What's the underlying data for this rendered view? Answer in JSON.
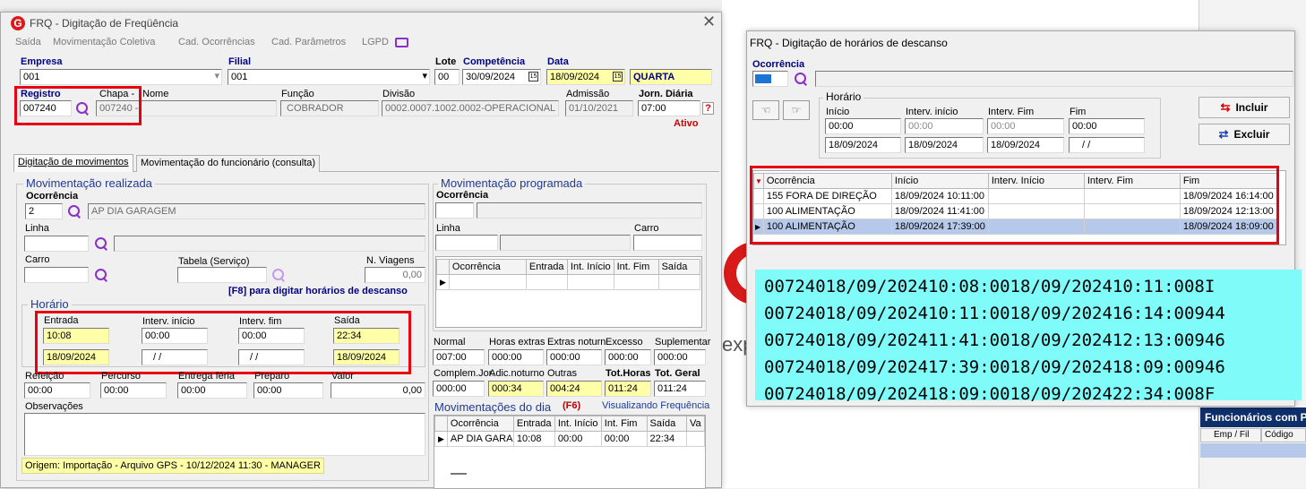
{
  "win1": {
    "title": "FRQ - Digitação de Freqüência",
    "menu": [
      "Saída",
      "Movimentação Coletiva",
      "Cad. Ocorrências",
      "Cad. Parâmetros",
      "LGPD"
    ],
    "empresa_label": "Empresa",
    "empresa_value": "001",
    "filial_label": "Filial",
    "filial_value": "001",
    "lote_label": "Lote",
    "lote_value": "00",
    "competencia_label": "Competência",
    "competencia_value": "30/09/2024",
    "data_label": "Data",
    "data_value": "18/09/2024",
    "dia_semana": "QUARTA",
    "registro_label": "Registro",
    "registro_value": "007240",
    "chapa_label": "Chapa -",
    "chapa_value": "007240 - ",
    "nome_label": "Nome",
    "funcao_label": "Função",
    "funcao_value": "COBRADOR",
    "divisao_label": "Divisão",
    "divisao_value": "0002.0007.1002.0002-OPERACIONAL",
    "admissao_label": "Admissão",
    "admissao_value": "01/10/2021",
    "jorn_label": "Jorn. Diária",
    "jorn_value": "07:00",
    "status": "Ativo",
    "tabs": [
      "Digitação de movimentos",
      "Movimentação do funcionário (consulta)"
    ],
    "mov_real": {
      "title": "Movimentação realizada",
      "ocorrencia_label": "Ocorrência",
      "ocorrencia_code": "2",
      "ocorrencia_desc": "AP DIA GARAGEM",
      "linha_label": "Linha",
      "carro_label": "Carro",
      "tabela_label": "Tabela (Serviço)",
      "nviagens_label": "N. Viagens",
      "nviagens_value": "0,00",
      "f8_hint": "[F8] para digitar horários de descanso",
      "horario_title": "Horário",
      "entrada_label": "Entrada",
      "entrada_value": "10:08",
      "entrada_data": "18/09/2024",
      "int_ini_label": "Interv. início",
      "int_ini_value": "00:00",
      "int_ini_data": "/ /",
      "int_fim_label": "Interv. fim",
      "int_fim_value": "00:00",
      "int_fim_data": "/ /",
      "saida_label": "Saída",
      "saida_value": "22:34",
      "saida_data": "18/09/2024",
      "refeicao_label": "Refeição",
      "refeicao_value": "00:00",
      "percurso_label": "Percurso",
      "percurso_value": "00:00",
      "entrega_label": "Entrega féria",
      "entrega_value": "00:00",
      "preparo_label": "Preparo",
      "preparo_value": "00:00",
      "valor_label": "Valor",
      "valor_value": "0,00",
      "obs_label": "Observações",
      "origem": "Origem: Importação - Arquivo GPS - 10/12/2024 11:30 - MANAGER"
    },
    "mov_prog": {
      "title": "Movimentação programada",
      "ocorrencia_label": "Ocorrência",
      "linha_label": "Linha",
      "carro_label": "Carro",
      "grid_headers": [
        "Ocorrência",
        "Entrada",
        "Int. Início",
        "Int. Fim",
        "Saída"
      ]
    },
    "totais": {
      "normal_label": "Normal",
      "normal_value": "007:00",
      "horas_extras_label": "Horas extras",
      "horas_extras_value": "000:00",
      "extras_not_label": "Extras noturn",
      "extras_not_value": "000:00",
      "excesso_label": "Excesso",
      "excesso_value": "000:00",
      "suplementar_label": "Suplementar",
      "suplementar_value": "000:00",
      "complem_label": "Complem.Jor.",
      "complem_value": "000:00",
      "adic_not_label": "Adic.noturno",
      "adic_not_value": "000:34",
      "outras_label": "Outras",
      "outras_value": "004:24",
      "tot_horas_label": "Tot.Horas",
      "tot_horas_value": "011:24",
      "tot_geral_label": "Tot. Geral",
      "tot_geral_value": "011:24"
    },
    "mov_dia": {
      "title": "Movimentações do dia",
      "hotkey": "(F6)",
      "status": "Visualizando Frequência",
      "headers": [
        "Ocorrência",
        "Entrada",
        "Int. Início",
        "Int. Fim",
        "Saída",
        "Va"
      ],
      "row": [
        "AP DIA GARAG",
        "10:08",
        "00:00",
        "00:00",
        "22:34",
        ""
      ]
    }
  },
  "win2": {
    "title": "FRQ - Digitação de horários de descanso",
    "ocorrencia_label": "Ocorrência",
    "horario_title": "Horário",
    "inicio_label": "Início",
    "inicio_value": "00:00",
    "inicio_data": "18/09/2024",
    "int_ini_label": "Interv. início",
    "int_ini_value": "00:00",
    "int_ini_data": "18/09/2024",
    "int_fim_label": "Interv. Fim",
    "int_fim_value": "00:00",
    "int_fim_data": "18/09/2024",
    "fim_label": "Fim",
    "fim_value": "00:00",
    "fim_data": "/ /",
    "incluir_label": "Incluir",
    "excluir_label": "Excluir",
    "grid_headers": [
      "Ocorrência",
      "Início",
      "Interv. Início",
      "Interv. Fim",
      "Fim"
    ],
    "rows": [
      [
        "155 FORA DE DIREÇÃO",
        "18/09/2024 10:11:00",
        "",
        "",
        "18/09/2024 16:14:00"
      ],
      [
        "100 ALIMENTAÇÃO",
        "18/09/2024 11:41:00",
        "",
        "",
        "18/09/2024 12:13:00"
      ],
      [
        "100 ALIMENTAÇÃO",
        "18/09/2024 17:39:00",
        "",
        "",
        "18/09/2024 18:09:00"
      ]
    ]
  },
  "overlay_lines": [
    "00724018/09/202410:08:0018/09/202410:11:008I",
    "00724018/09/202410:11:0018/09/202416:14:00944",
    "00724018/09/202411:41:0018/09/202412:13:00946",
    "00724018/09/202417:39:0018/09/202418:09:00946",
    "00724018/09/202418:09:0018/09/202422:34:008F"
  ],
  "background": {
    "funcionarios_title": "Funcionários com P",
    "col_emp": "Emp / Fil",
    "col_codigo": "Código",
    "side_text": "exp"
  },
  "colors": {
    "accent_red": "#e60012",
    "highlight_yellow": "#ffffa8",
    "overlay_cyan": "#7ffcf9",
    "selected_row": "#b7c9ea"
  }
}
